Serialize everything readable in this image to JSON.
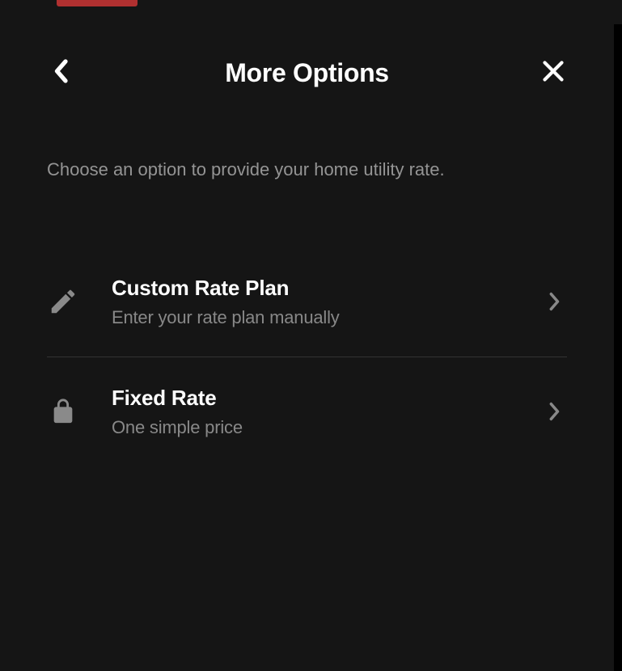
{
  "header": {
    "title": "More Options"
  },
  "subtitle": "Choose an option to provide your home utility rate.",
  "options": [
    {
      "title": "Custom Rate Plan",
      "subtitle": "Enter your rate plan manually"
    },
    {
      "title": "Fixed Rate",
      "subtitle": "One simple price"
    }
  ]
}
